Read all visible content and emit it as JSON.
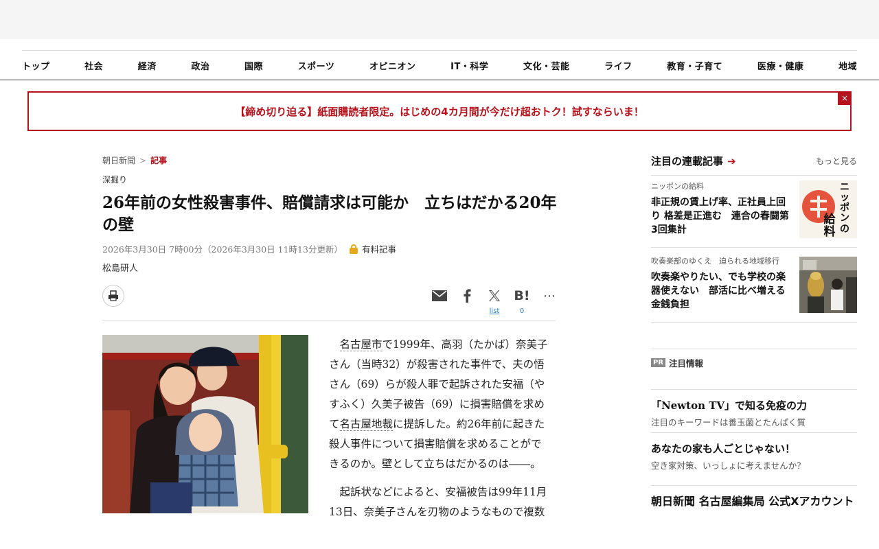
{
  "nav": [
    "トップ",
    "社会",
    "経済",
    "政治",
    "国際",
    "スポーツ",
    "オピニオン",
    "IT・科学",
    "文化・芸能",
    "ライフ",
    "教育・子育て",
    "医療・健康",
    "地域"
  ],
  "promo": {
    "text": "【締め切り迫る】紙面購読者限定。はじめの4カ月間が今だけ超おトク！試すならいま！",
    "close": "×"
  },
  "breadcrumb": {
    "home": "朝日新聞",
    "sep": ">",
    "current": "記事"
  },
  "article": {
    "category": "深掘り",
    "title": "26年前の女性殺害事件、賠償請求は可能か　立ちはだかる20年の壁",
    "date": "2026年3月30日 7時00分（2026年3月30日 11時13分更新）",
    "paid_label": "有料記事",
    "author": "松島研人",
    "p1_kw1": "名古屋市",
    "p1_a": "で1999年、高羽（たかば）奈美子さん（当時32）が殺害された事件で、夫の悟さん（69）らが殺人罪で起訴された安福（やすふく）久美子被告（69）に損害賠償を求めて",
    "p1_kw2": "名古屋地裁",
    "p1_b": "に提訴した。約26年前に起きた殺人事件について損害賠償を求めることができるのか。壁として立ちはだかるのは――。",
    "p2": "起訴状などによると、安福被告は99年11月13日、奈美子さんを刃物のようなもので複数"
  },
  "share": {
    "x_count": "list",
    "hatena_count": "0",
    "hatena_label": "B!",
    "more": "⋯"
  },
  "sidebar": {
    "series_title": "注目の連載記事",
    "series_arrow": "➔",
    "more": "もっと見る",
    "items": [
      {
        "kicker": "ニッポンの給料",
        "title": "非正規の賃上げ率、正社員上回り 格差是正進む　連合の春闘第3回集計",
        "thumb_text": "ニッポンの給料"
      },
      {
        "kicker": "吹奏楽部のゆくえ　迫られる地域移行",
        "title": "吹奏楽やりたい、でも学校の楽器使えない　部活に比べ増える金銭負担"
      }
    ],
    "pr_badge": "PR",
    "pr_label": "注目情報",
    "pr_items": [
      {
        "title": "「Newton TV」で知る免疫の力",
        "desc": "注目のキーワードは善玉菌とたんぱく質"
      },
      {
        "title": "あなたの家も人ごとじゃない！",
        "desc": "空き家対策、いっしょに考えませんか？"
      }
    ],
    "nagoya": "朝日新聞 名古屋編集局 公式Xアカウント"
  }
}
